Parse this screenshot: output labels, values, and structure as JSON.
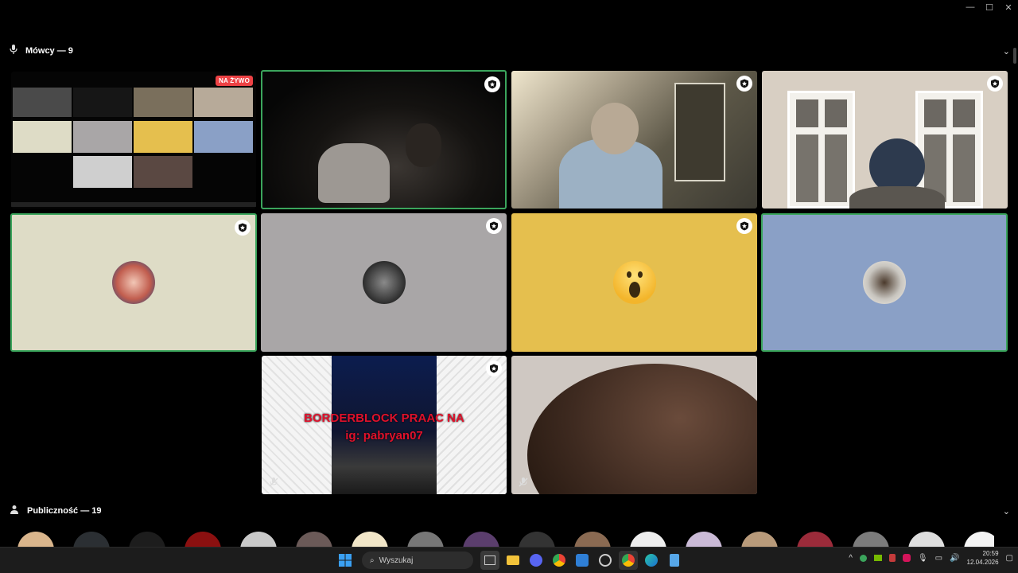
{
  "window": {
    "minimize": "—",
    "maximize": "☐",
    "close": "✕"
  },
  "speakers_section": {
    "label": "Mówcy — 9",
    "icon": "microphone-icon"
  },
  "audience_section": {
    "label": "Publiczność — 19",
    "icon": "people-icon"
  },
  "stream_tile": {
    "live_badge": "NA ŻYWO"
  },
  "tiles": [
    {
      "id": "stream",
      "kind": "screen-share"
    },
    {
      "id": "speaker-dark-room",
      "kind": "video",
      "active": true
    },
    {
      "id": "speaker-bookshelf",
      "kind": "video"
    },
    {
      "id": "speaker-window",
      "kind": "video"
    },
    {
      "id": "speaker-cream",
      "kind": "avatar",
      "bg": "#dedcc6",
      "active": true
    },
    {
      "id": "speaker-grey",
      "kind": "avatar",
      "bg": "#a9a6a7"
    },
    {
      "id": "speaker-yellow",
      "kind": "avatar",
      "bg": "#e5bf4e"
    },
    {
      "id": "speaker-blue",
      "kind": "avatar",
      "bg": "#8aa0c6",
      "active": true
    },
    {
      "id": "speaker-manga",
      "kind": "video",
      "muted": true
    },
    {
      "id": "speaker-hair",
      "kind": "video",
      "muted": true
    }
  ],
  "manga_overlay": {
    "line1": "BORDERBLOCK PRAAC NA",
    "line2": "ig: pabryan07"
  },
  "audience_count": 19,
  "taskbar": {
    "search_placeholder": "Wyszukaj",
    "time": "20:59",
    "date": "12.04.2026",
    "tray_up": "^"
  },
  "colors": {
    "active_border": "#3ba55c",
    "live": "#ed4245",
    "background": "#000000"
  }
}
